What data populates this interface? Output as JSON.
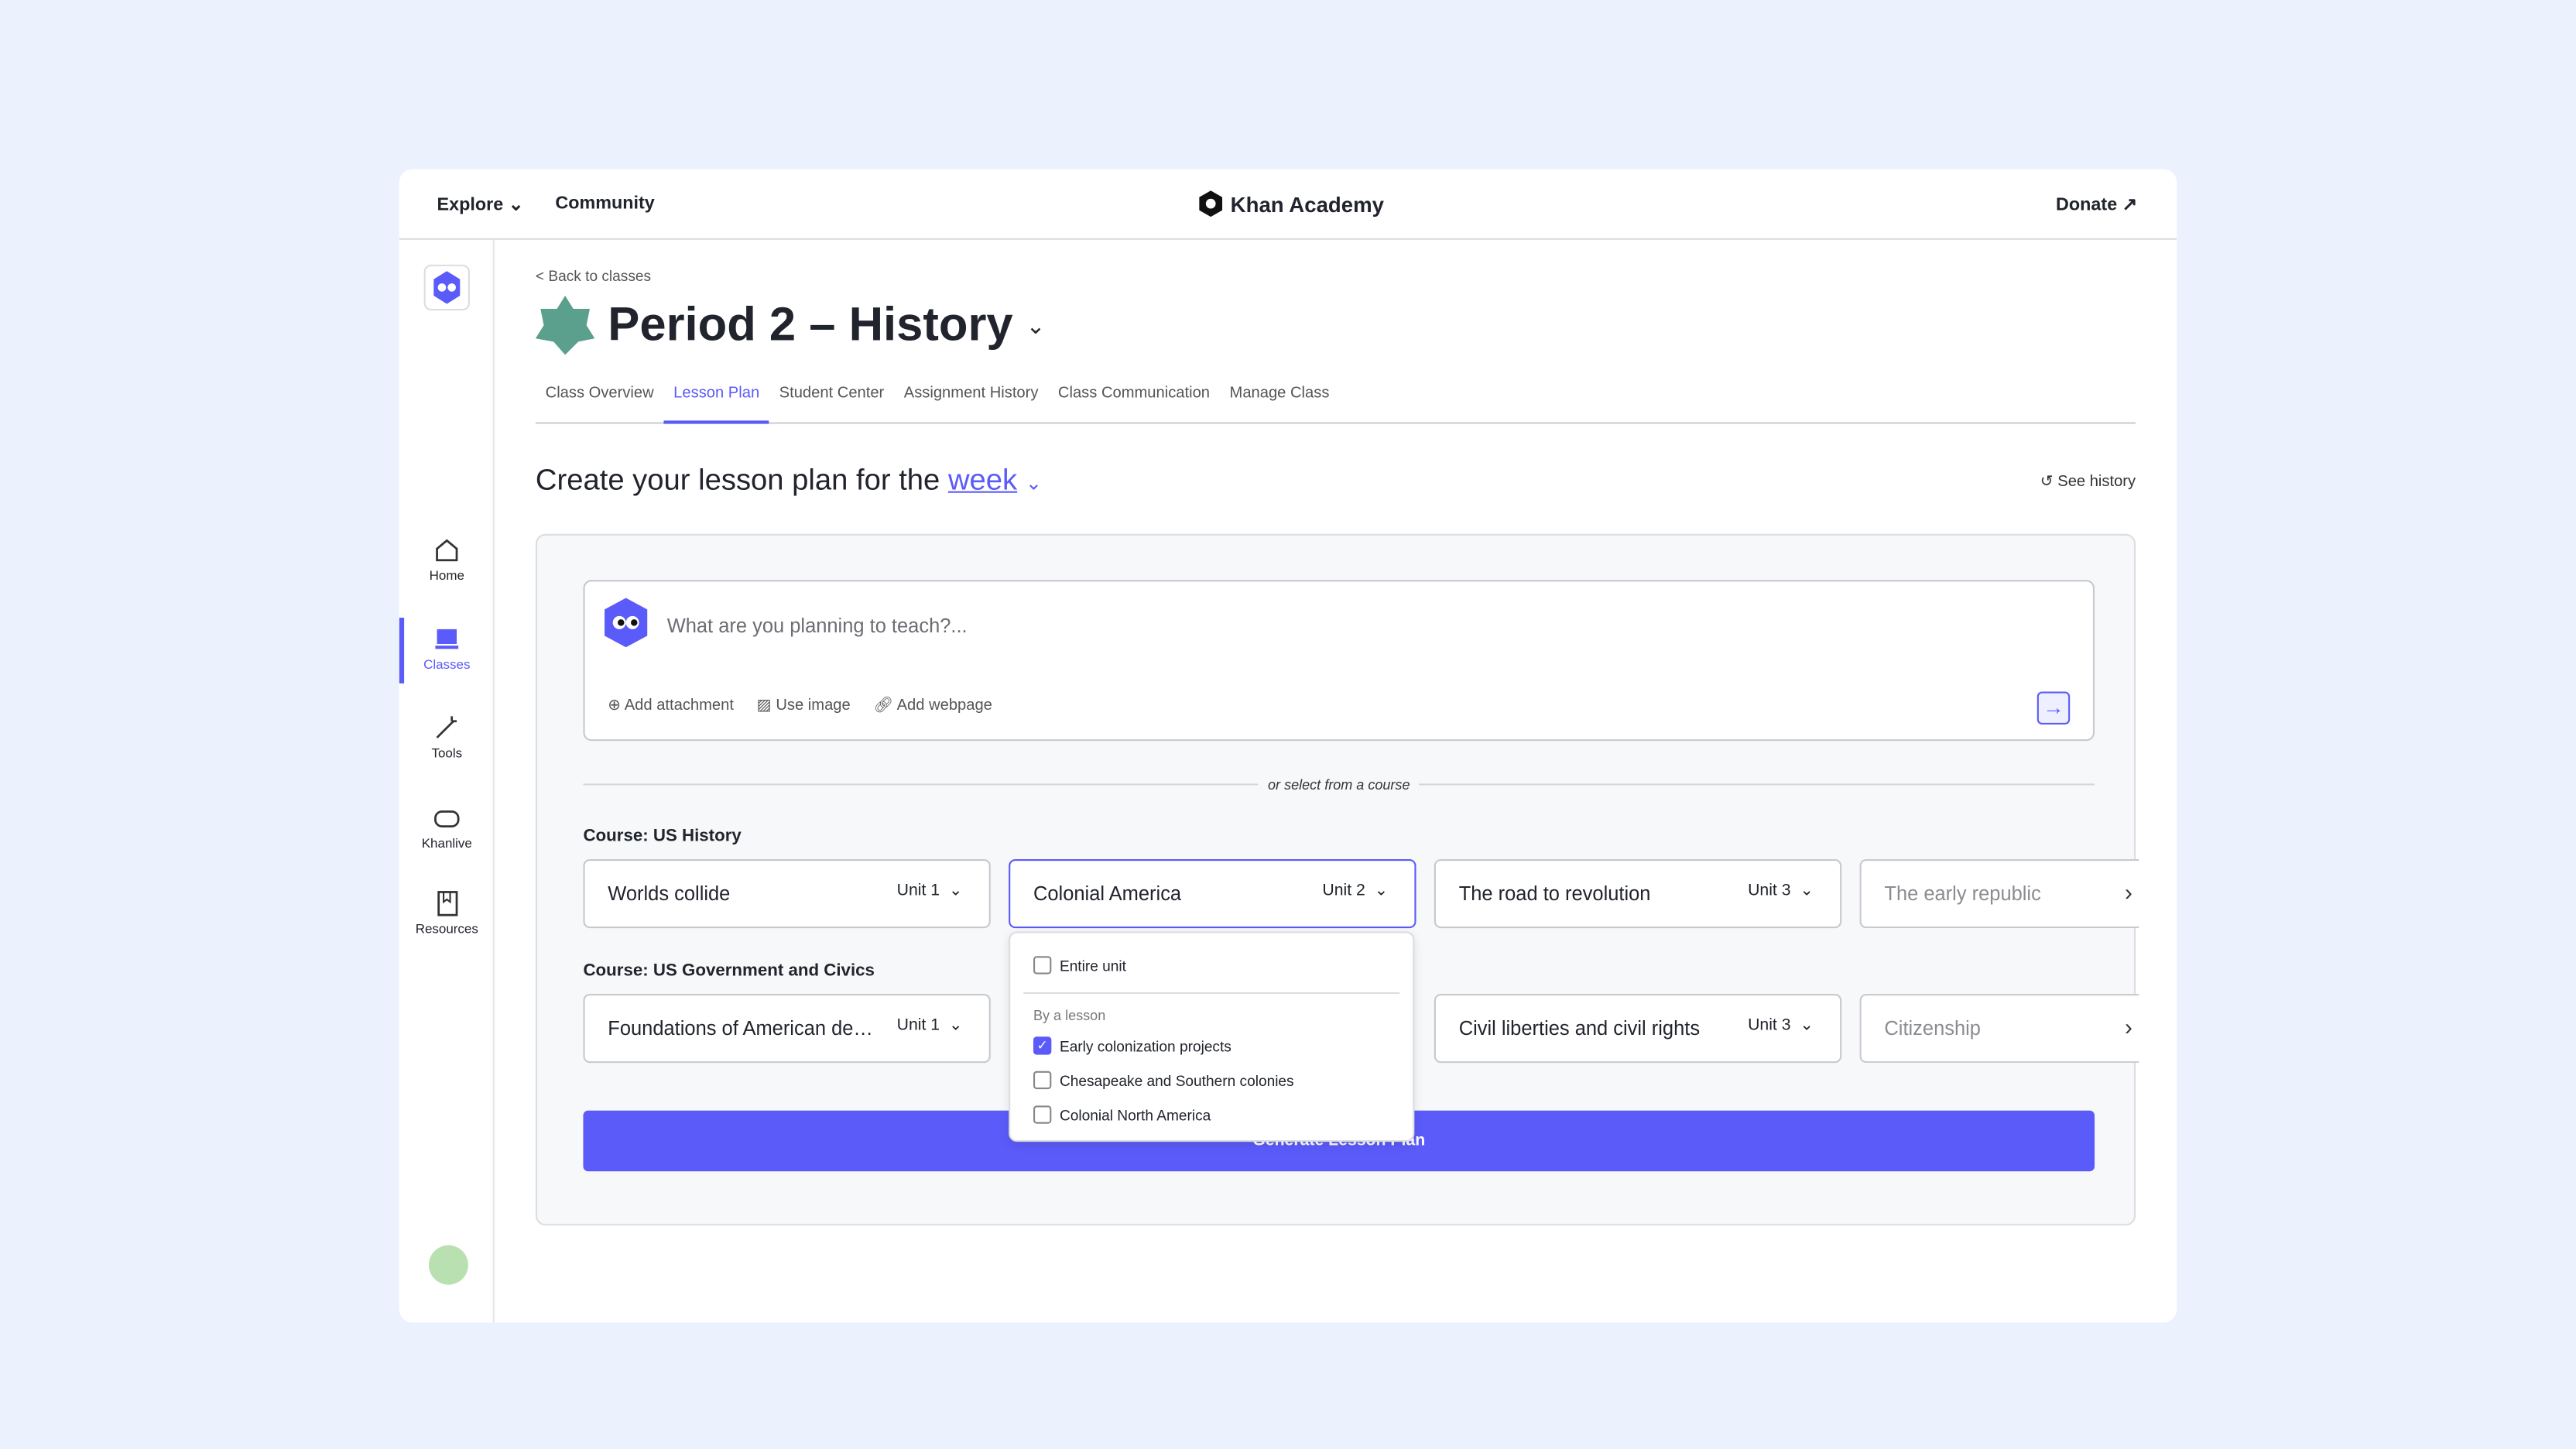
{
  "topbar": {
    "explore": "Explore",
    "community": "Community",
    "brand": "Khan Academy",
    "donate": "Donate"
  },
  "sidebar": {
    "items": [
      {
        "label": "Home"
      },
      {
        "label": "Classes"
      },
      {
        "label": "Tools"
      },
      {
        "label": "Khanlive"
      },
      {
        "label": "Resources"
      }
    ],
    "active": "Classes"
  },
  "header": {
    "back": "< Back to classes",
    "title": "Period 2 – History"
  },
  "tabs": [
    "Class Overview",
    "Lesson Plan",
    "Student Center",
    "Assignment History",
    "Class Communication",
    "Manage Class"
  ],
  "active_tab": "Lesson Plan",
  "plan": {
    "heading": "Create your lesson plan for the",
    "period": "week",
    "see_history": "See history"
  },
  "prompt": {
    "placeholder": "What are you planning to teach?...",
    "add_attachment": "Add attachment",
    "use_image": "Use image",
    "add_webpage": "Add webpage"
  },
  "divider": "or select from a course",
  "courses": [
    {
      "title": "Course: US History",
      "units": [
        {
          "name": "Worlds collide",
          "unit": "Unit 1"
        },
        {
          "name": "Colonial America",
          "unit": "Unit 2"
        },
        {
          "name": "The road to revolution",
          "unit": "Unit 3"
        },
        {
          "name": "The early republic",
          "unit": ""
        }
      ]
    },
    {
      "title": "Course: US Government and Civics",
      "units": [
        {
          "name": "Foundations of American de…",
          "unit": "Unit 1"
        },
        {
          "name": "",
          "unit": ""
        },
        {
          "name": "Civil liberties and civil rights",
          "unit": "Unit 3"
        },
        {
          "name": "Citizenship",
          "unit": ""
        }
      ]
    }
  ],
  "dropdown": {
    "entire_unit": "Entire unit",
    "by_lesson": "By a lesson",
    "lessons": [
      {
        "label": "Early colonization projects",
        "checked": true
      },
      {
        "label": "Chesapeake and Southern colonies",
        "checked": false
      },
      {
        "label": "Colonial North America",
        "checked": false
      }
    ]
  },
  "generate": "Generate Lesson Plan",
  "colors": {
    "accent": "#5b5bfa",
    "class_badge": "#5aa08c",
    "background": "#ecf2fd"
  }
}
